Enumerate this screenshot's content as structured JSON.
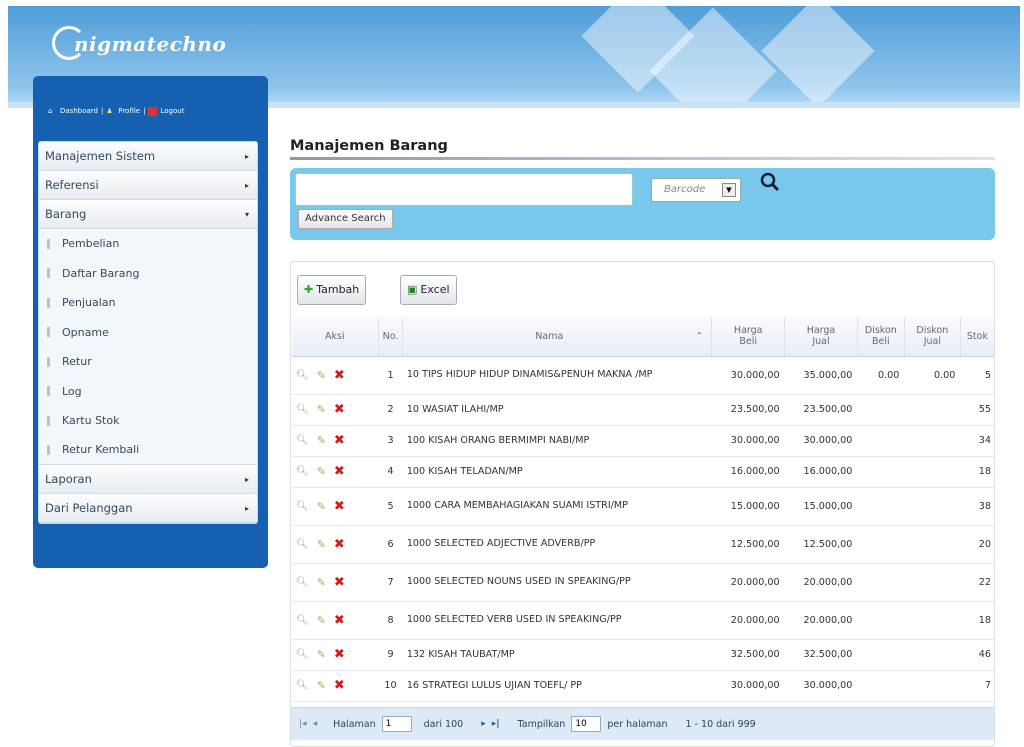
{
  "header": {
    "logo_text": "nigmatechno"
  },
  "topnav": {
    "dashboard": "Dashboard",
    "profile": "Profile",
    "logout": "Logout"
  },
  "sidebar": {
    "items": [
      {
        "label": "Manajemen Sistem",
        "arrow": "▸"
      },
      {
        "label": "Referensi",
        "arrow": "▸"
      },
      {
        "label": "Barang",
        "arrow": "▾"
      }
    ],
    "subitems": [
      "Pembelian",
      "Daftar Barang",
      "Penjualan",
      "Opname",
      "Retur",
      "Log",
      "Kartu Stok",
      "Retur Kembali"
    ],
    "bottom_items": [
      {
        "label": "Laporan",
        "arrow": "▸"
      },
      {
        "label": "Dari Pelanggan",
        "arrow": "▸"
      }
    ]
  },
  "main": {
    "title": "Manajemen Barang",
    "search": {
      "value": "",
      "type_selected": "Barcode",
      "advance_label": "Advance Search"
    },
    "toolbar": {
      "add_label": "Tambah",
      "excel_label": "Excel"
    },
    "columns": {
      "aksi": "Aksi",
      "no": "No.",
      "nama": "Nama",
      "harga_beli_1": "Harga",
      "harga_beli_2": "Beli",
      "harga_jual_1": "Harga",
      "harga_jual_2": "Jual",
      "diskon_beli_1": "Diskon",
      "diskon_beli_2": "Beli",
      "diskon_jual_1": "Diskon",
      "diskon_jual_2": "Jual",
      "stok": "Stok"
    },
    "rows": [
      {
        "no": "1",
        "nama": "10 TIPS HIDUP HIDUP DINAMIS&PENUH MAKNA /MP",
        "beli": "30.000,00",
        "jual": "35.000,00",
        "dbeli": "0.00",
        "djual": "0.00",
        "stok": "5"
      },
      {
        "no": "2",
        "nama": "10 WASIAT ILAHI/MP",
        "beli": "23.500,00",
        "jual": "23.500,00",
        "dbeli": "",
        "djual": "",
        "stok": "55"
      },
      {
        "no": "3",
        "nama": "100 KISAH ORANG BERMIMPI NABI/MP",
        "beli": "30.000,00",
        "jual": "30.000,00",
        "dbeli": "",
        "djual": "",
        "stok": "34"
      },
      {
        "no": "4",
        "nama": "100 KISAH TELADAN/MP",
        "beli": "16.000,00",
        "jual": "16.000,00",
        "dbeli": "",
        "djual": "",
        "stok": "18"
      },
      {
        "no": "5",
        "nama": "1000 CARA MEMBAHAGIAKAN SUAMI ISTRI/MP",
        "beli": "15.000,00",
        "jual": "15.000,00",
        "dbeli": "",
        "djual": "",
        "stok": "38"
      },
      {
        "no": "6",
        "nama": "1000 SELECTED ADJECTIVE ADVERB/PP",
        "beli": "12.500,00",
        "jual": "12.500,00",
        "dbeli": "",
        "djual": "",
        "stok": "20"
      },
      {
        "no": "7",
        "nama": "1000 SELECTED NOUNS USED IN SPEAKING/PP",
        "beli": "20.000,00",
        "jual": "20.000,00",
        "dbeli": "",
        "djual": "",
        "stok": "22"
      },
      {
        "no": "8",
        "nama": "1000 SELECTED VERB USED IN SPEAKING/PP",
        "beli": "20.000,00",
        "jual": "20.000,00",
        "dbeli": "",
        "djual": "",
        "stok": "18"
      },
      {
        "no": "9",
        "nama": "132 KISAH TAUBAT/MP",
        "beli": "32.500,00",
        "jual": "32.500,00",
        "dbeli": "",
        "djual": "",
        "stok": "46"
      },
      {
        "no": "10",
        "nama": "16 STRATEGI LULUS UJIAN TOEFL/ PP",
        "beli": "30.000,00",
        "jual": "30.000,00",
        "dbeli": "",
        "djual": "",
        "stok": "7"
      }
    ],
    "pager": {
      "halaman_label": "Halaman",
      "page": "1",
      "dari_label": "dari 100",
      "tampilkan_label": "Tampilkan",
      "per_page": "10",
      "per_halaman_label": "per halaman",
      "range": "1 - 10 dari 999"
    }
  }
}
